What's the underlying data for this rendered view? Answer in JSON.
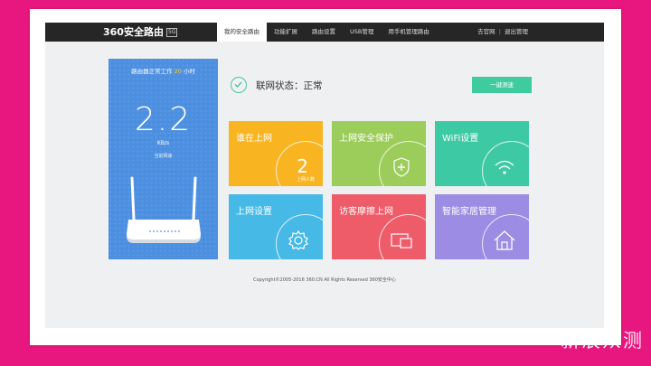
{
  "brand": {
    "name": "360安全路由",
    "badge": "5G"
  },
  "nav": {
    "items": [
      {
        "label": "我的安全路由",
        "active": true
      },
      {
        "label": "功能扩展",
        "active": false
      },
      {
        "label": "路由设置",
        "active": false
      },
      {
        "label": "USB管理",
        "active": false
      },
      {
        "label": "用手机管理路由",
        "active": false
      }
    ],
    "right": {
      "link1": "去官网",
      "sep": "|",
      "link2": "退出管理"
    }
  },
  "router_panel": {
    "work_prefix": "路由器正常工作",
    "work_hours": "20",
    "work_suffix": "小时",
    "speed": "2.2",
    "speed_unit": "KB/s",
    "speed_caption": "当前网速"
  },
  "status": {
    "text": "联网状态：正常",
    "speed_test_button": "一键测速"
  },
  "tiles": [
    {
      "label": "谁在上网",
      "number": "2",
      "sub": "上网人数",
      "icon": "none",
      "color": "#f9b421"
    },
    {
      "label": "上网安全保护",
      "icon": "shield-plus-icon",
      "color": "#9ccd5a"
    },
    {
      "label": "WiFi设置",
      "icon": "wifi-icon",
      "color": "#3ec9a5"
    },
    {
      "label": "上网设置",
      "icon": "gear-icon",
      "color": "#47b9e6"
    },
    {
      "label": "访客摩擦上网",
      "icon": "monitor-icon",
      "color": "#ee5b69"
    },
    {
      "label": "智能家居管理",
      "icon": "house-icon",
      "color": "#9c8ce3"
    }
  ],
  "footer": {
    "copyright": "Copyright©2005-2016 360.CN All Rights Reserved 360安全中心"
  },
  "watermark": {
    "text": "新浪众测"
  },
  "colors": {
    "page_background": "#e8177f",
    "topbar": "#262626",
    "accent_green": "#3ecb9d",
    "router_panel": "#4c8fe0"
  }
}
